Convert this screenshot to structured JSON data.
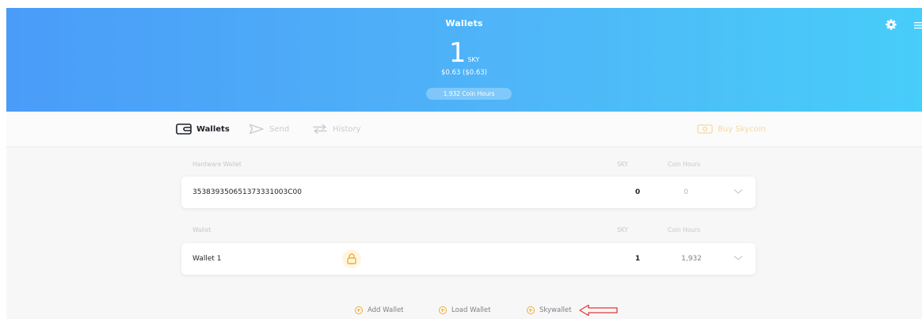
{
  "header": {
    "title": "Wallets",
    "balance_value": "1",
    "balance_unit": "SKY",
    "balance_usd": "$0.63 ($0.63)",
    "coin_hours": "1,932 Coin Hours"
  },
  "nav": {
    "wallets": "Wallets",
    "send": "Send",
    "history": "History",
    "buy": "Buy Skycoin"
  },
  "hardware": {
    "section_label": "Hardware Wallet",
    "col_sky": "SKY",
    "col_hours": "Coin Hours",
    "row": {
      "name": "353839350651373331003C00",
      "sky": "0",
      "hours": "0"
    }
  },
  "software": {
    "section_label": "Wallet",
    "col_sky": "SKY",
    "col_hours": "Coin Hours",
    "row": {
      "name": "Wallet 1",
      "sky": "1",
      "hours": "1,932"
    }
  },
  "actions": {
    "add_wallet": "Add Wallet",
    "load_wallet": "Load Wallet",
    "skywallet": "Skywallet"
  },
  "colors": {
    "accent": "#f3ac2d",
    "header_start": "#4a9cf8",
    "header_end": "#47cdf9",
    "annotation_arrow": "#e23b3b"
  }
}
